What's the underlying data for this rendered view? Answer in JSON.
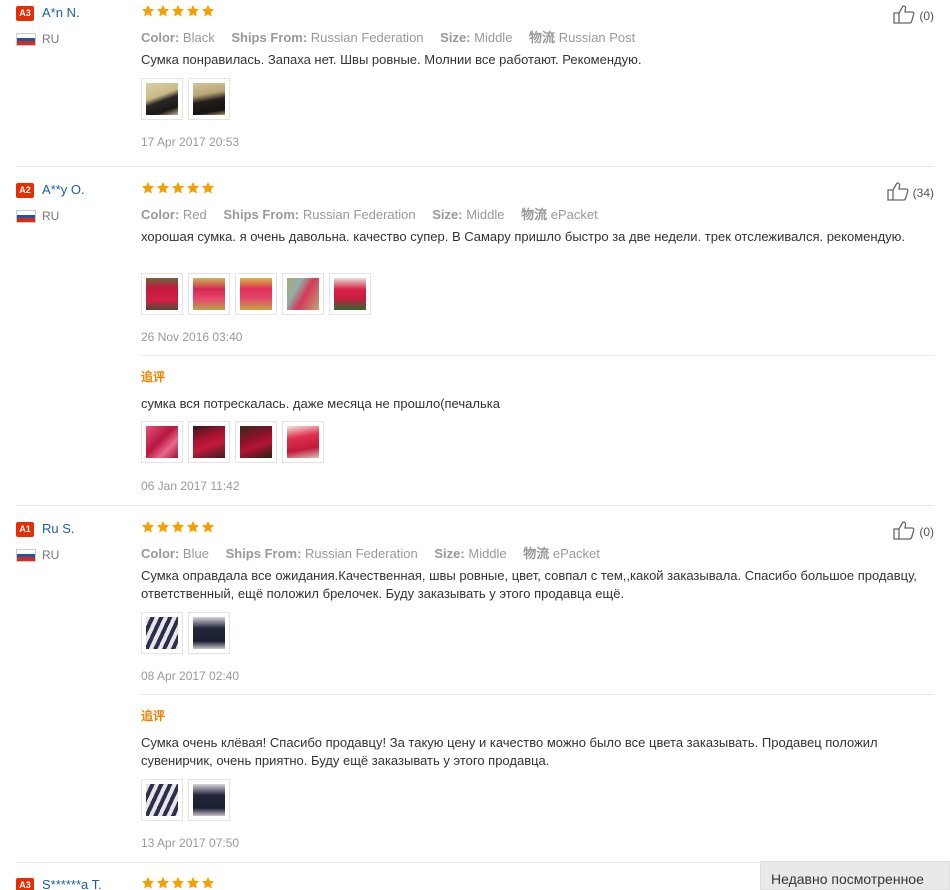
{
  "colors": {
    "star": "#f6a000",
    "badge": "#e62e04",
    "name": "#1a5dac",
    "follow": "#f08200"
  },
  "labels": {
    "color": "Color:",
    "ships": "Ships From:",
    "size": "Size:",
    "logistics": "物流",
    "follow_up": "追评"
  },
  "reviews": [
    {
      "badge": "A3",
      "name": "A*n N.",
      "country": "RU",
      "stars": 5,
      "helpful": "(0)",
      "color": "Black",
      "ships": "Russian Federation",
      "size": "Middle",
      "logistics": "Russian Post",
      "text": "Сумка понравилась. Запаха нет. Швы ровные. Молнии все работают. Рекомендую.",
      "date": "17 Apr 2017 20:53"
    },
    {
      "badge": "A2",
      "name": "A**y O.",
      "country": "RU",
      "stars": 5,
      "helpful": "(34)",
      "color": "Red",
      "ships": "Russian Federation",
      "size": "Middle",
      "logistics": "ePacket",
      "text": "хорошая сумка. я очень давольна. качество супер. В Самару пришло быстро за две недели. трек отслеживался. рекомендую.",
      "date": "26 Nov 2016 03:40",
      "followup_text": "сумка вся потрескалась. даже месяца не прошло(печалька",
      "followup_date": "06 Jan 2017 11:42"
    },
    {
      "badge": "A1",
      "name": "Ru S.",
      "country": "RU",
      "stars": 5,
      "helpful": "(0)",
      "color": "Blue",
      "ships": "Russian Federation",
      "size": "Middle",
      "logistics": "ePacket",
      "text": "Сумка оправдала все ожидания.Качественная, швы ровные, цвет, совпал с тем,,какой заказывала. Спасибо большое продавцу, ответственный, ещё положил брелочек. Буду заказывать у этого продавца ещё.",
      "date": "08 Apr 2017 02:40",
      "followup_text": "Сумка очень клёвая! Спасибо продавцу! За такую цену и качество можно было все цвета заказывать. Продавец положил сувенирчик, очень приятно. Буду ещё заказывать у этого продавца.",
      "followup_date": "13 Apr 2017 07:50"
    },
    {
      "badge": "A3",
      "name": "S******a T.",
      "stars": 5
    }
  ],
  "recently_viewed": "Недавно посмотренное"
}
